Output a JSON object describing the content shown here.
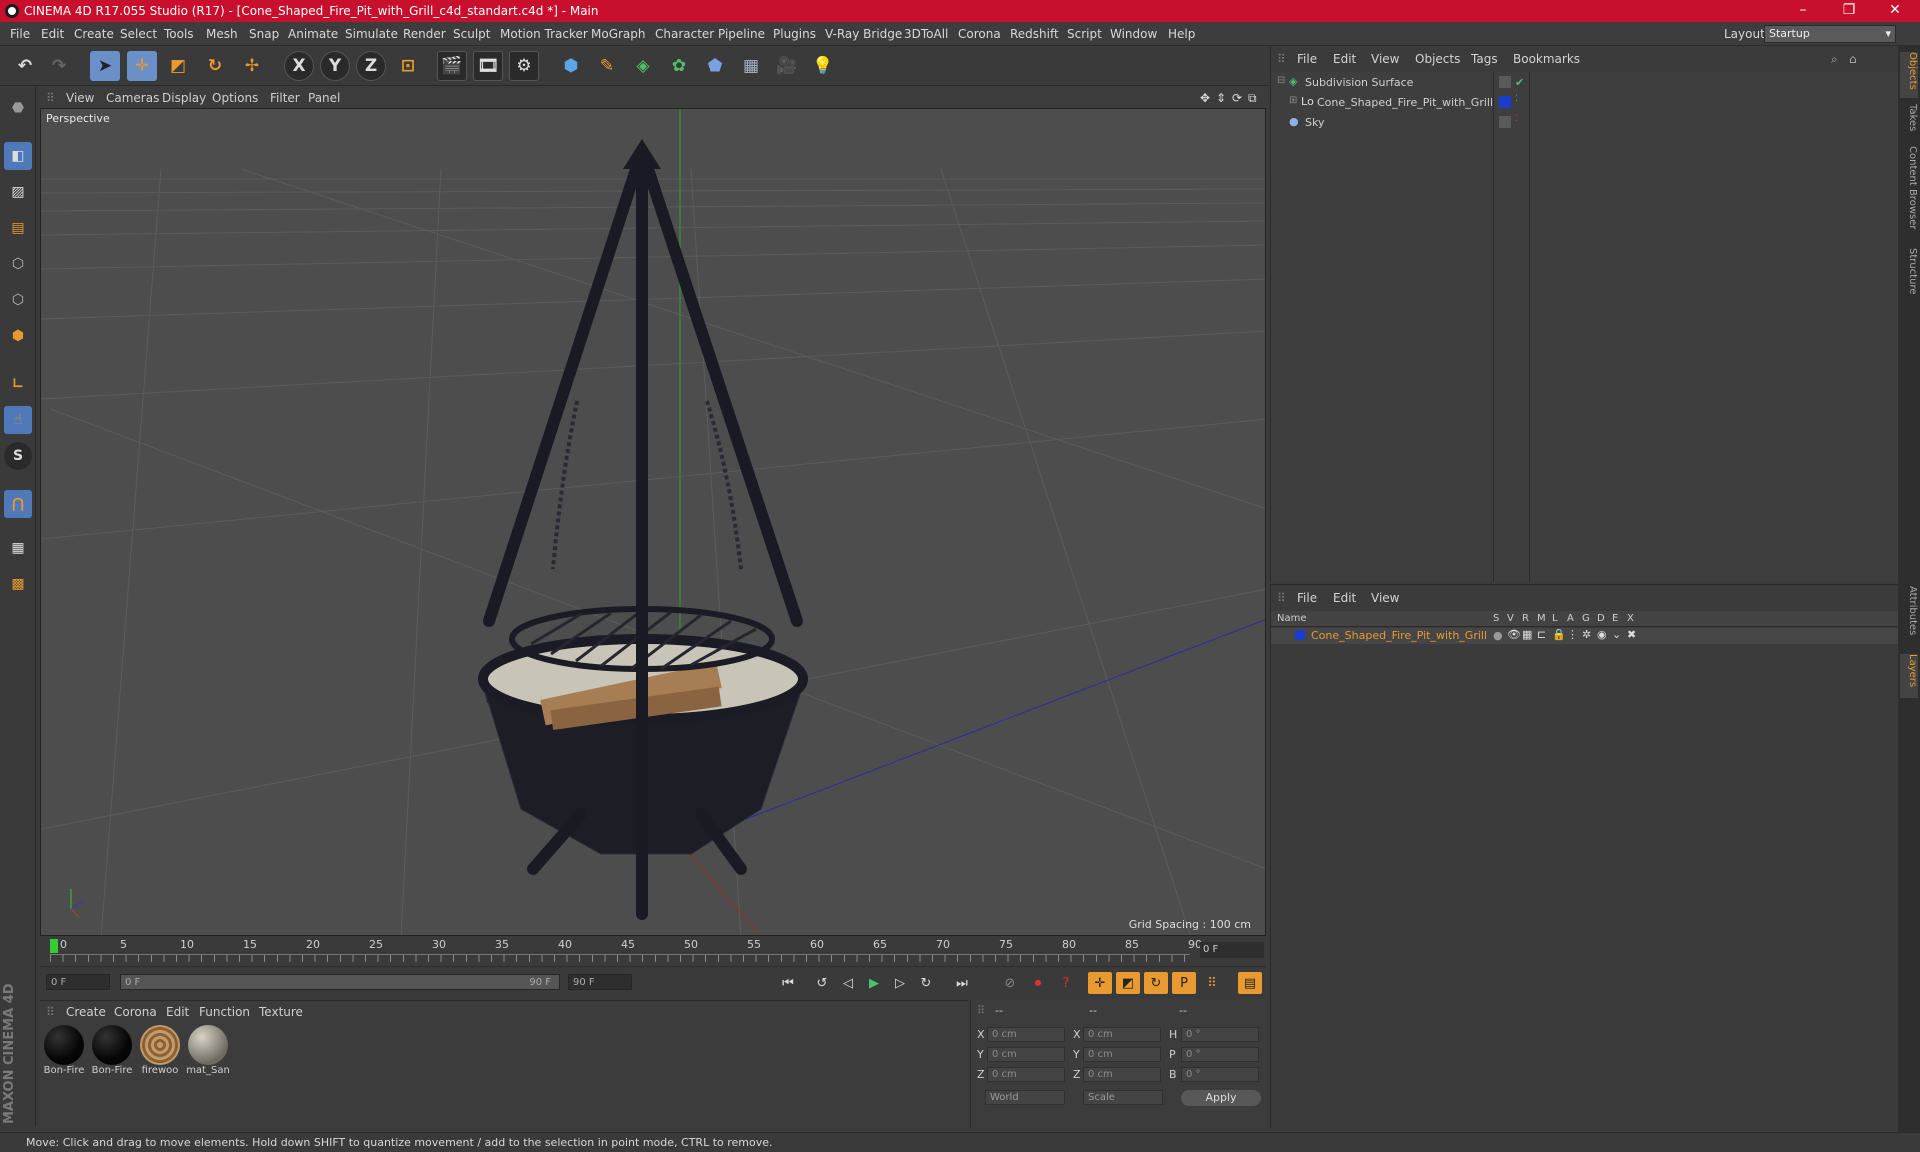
{
  "window": {
    "title": "CINEMA 4D R17.055 Studio (R17) - [Cone_Shaped_Fire_Pit_with_Grill_c4d_standart.c4d *] - Main",
    "controls": [
      "–",
      "❐",
      "✕"
    ]
  },
  "menubar": {
    "items": [
      "File",
      "Edit",
      "Create",
      "Select",
      "Tools",
      "Mesh",
      "Snap",
      "Animate",
      "Simulate",
      "Render",
      "Sculpt",
      "Motion Tracker",
      "MoGraph",
      "Character",
      "Pipeline",
      "Plugins",
      "V-Ray Bridge",
      "3DToAll",
      "Corona",
      "Redshift",
      "Script",
      "Window",
      "Help"
    ],
    "layout_label": "Layout:",
    "layout_value": "Startup"
  },
  "toolbar": {
    "axis_x": "X",
    "axis_y": "Y",
    "axis_z": "Z"
  },
  "viewport": {
    "menu": [
      "View",
      "Cameras",
      "Display",
      "Options",
      "Filter",
      "Panel"
    ],
    "label": "Perspective",
    "grid_spacing": "Grid Spacing : 100 cm"
  },
  "timeline": {
    "ticks": [
      "0",
      "5",
      "10",
      "15",
      "20",
      "25",
      "30",
      "35",
      "40",
      "45",
      "50",
      "55",
      "60",
      "65",
      "70",
      "75",
      "80",
      "85",
      "90"
    ],
    "current_frame": "0 F"
  },
  "transport": {
    "start": "0 F",
    "range_start": "0 F",
    "range_end": "90 F",
    "end": "90 F"
  },
  "materials": {
    "menu": [
      "Create",
      "Corona",
      "Edit",
      "Function",
      "Texture"
    ],
    "items": [
      {
        "name": "Bon-Fire",
        "color": "#050505"
      },
      {
        "name": "Bon-Fire",
        "color": "#050505"
      },
      {
        "name": "firewoo",
        "color": "#a27a4e"
      },
      {
        "name": "mat_San",
        "color": "#a8a294"
      }
    ]
  },
  "coords": {
    "header": [
      "--",
      "--",
      "--"
    ],
    "rows": [
      {
        "l1": "X",
        "v1": "0 cm",
        "l2": "X",
        "v2": "0 cm",
        "l3": "H",
        "v3": "0 °"
      },
      {
        "l1": "Y",
        "v1": "0 cm",
        "l2": "Y",
        "v2": "0 cm",
        "l3": "P",
        "v3": "0 °"
      },
      {
        "l1": "Z",
        "v1": "0 cm",
        "l2": "Z",
        "v2": "0 cm",
        "l3": "B",
        "v3": "0 °"
      }
    ],
    "mode1": "World",
    "mode2": "Scale",
    "apply": "Apply"
  },
  "object_manager": {
    "menu": [
      "File",
      "Edit",
      "View",
      "Objects",
      "Tags",
      "Bookmarks"
    ],
    "objects": [
      {
        "name": "Subdivision Surface",
        "icon": "subdivision-icon"
      },
      {
        "name": "Cone_Shaped_Fire_Pit_with_Grill",
        "icon": "null-object-icon"
      },
      {
        "name": "Sky",
        "icon": "sky-icon"
      }
    ]
  },
  "layer_manager": {
    "menu": [
      "File",
      "Edit",
      "View"
    ],
    "columns": [
      "Name",
      "S",
      "V",
      "R",
      "M",
      "L",
      "A",
      "G",
      "D",
      "E",
      "X"
    ],
    "layers": [
      {
        "name": "Cone_Shaped_Fire_Pit_with_Grill",
        "color": "#1a3ccf"
      }
    ]
  },
  "right_tabs": [
    "Objects",
    "Takes",
    "Content Browser",
    "Structure",
    "Attributes",
    "Layers"
  ],
  "status": "Move: Click and drag to move elements. Hold down SHIFT to quantize movement / add to the selection in point mode, CTRL to remove.",
  "brand": "MAXON CINEMA 4D",
  "colors": {
    "accent": "#e89a30",
    "title_bar": "#c8102e",
    "selection": "#6b8fc7"
  }
}
